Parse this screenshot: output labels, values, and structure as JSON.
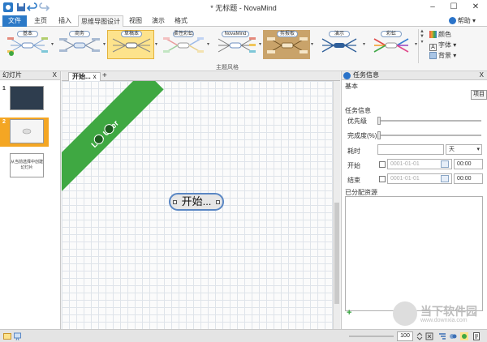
{
  "window": {
    "title": "* 无标题 - NovaMind",
    "minimize": "–",
    "maximize": "☐",
    "close": "✕"
  },
  "tabs": {
    "file": "文件",
    "home": "主页",
    "insert": "插入",
    "mindmap_design": "思维导图设计",
    "view": "视图",
    "present": "演示",
    "format": "格式"
  },
  "help": {
    "label": "帮助 ▾"
  },
  "ribbon": {
    "themes": [
      {
        "label": "基本",
        "selected": false
      },
      {
        "label": "商务",
        "selected": false
      },
      {
        "label": "草稿本",
        "selected": true
      },
      {
        "label": "柔性彩虹",
        "selected": false
      },
      {
        "label": "NovaMind",
        "selected": false
      },
      {
        "label": "剪报板",
        "selected": false
      },
      {
        "label": "演示",
        "selected": false
      },
      {
        "label": "彩虹",
        "selected": false
      }
    ],
    "group_label": "主题风格",
    "side": {
      "color": "颜色",
      "font": "字体 ▾",
      "background": "背景 ▾",
      "font_icon": "A"
    }
  },
  "slides_pane": {
    "title": "幻灯片",
    "close": "X",
    "slides": [
      {
        "number": "1",
        "caption": ""
      },
      {
        "number": "2",
        "caption": ""
      },
      {
        "number": "",
        "caption": "从当前选择中创建幻灯片"
      }
    ]
  },
  "document": {
    "tab_label": "开始...",
    "tab_close": "x",
    "add": "+"
  },
  "canvas": {
    "banner_text": "Lite User",
    "central_node": "开始..."
  },
  "task_panel": {
    "title": "任务信息",
    "close": "X",
    "basic_section": "基本",
    "project_button": "项目",
    "task_section": "任务信息",
    "priority_label": "优先级",
    "completion_label": "完成度(%)",
    "duration_label": "耗时",
    "duration_unit": "天",
    "start_label": "开始",
    "start_date_placeholder": "0001-01-01",
    "start_time": "00:00",
    "end_label": "结束",
    "end_date_placeholder": "0001-01-01",
    "end_time": "00:00",
    "resources_label": "已分配资源",
    "add_resource": "+"
  },
  "status_bar": {
    "zoom": "100"
  },
  "watermark": {
    "title": "当下软件园",
    "subtitle": "www.downxia.com"
  },
  "colors": {
    "accent": "#2b79c7",
    "selected_theme": "#fde38c",
    "banner": "#3fa842",
    "node_border": "#5a87c4",
    "current_slide": "#f4a623"
  }
}
